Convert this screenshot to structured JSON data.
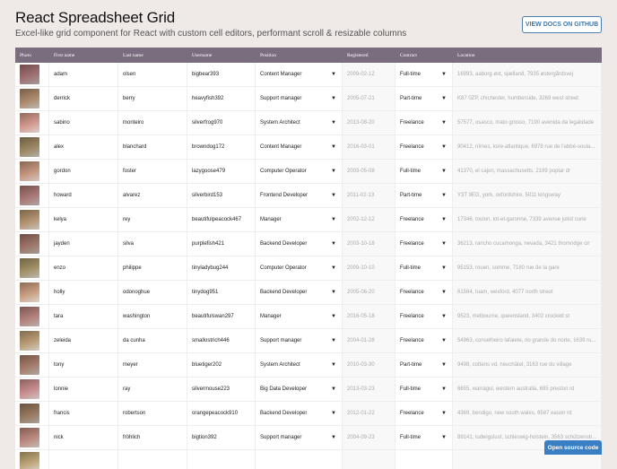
{
  "header": {
    "title": "React Spreadsheet Grid",
    "subtitle": "Excel-like grid component for React with custom cell editors, performant scroll & resizable columns",
    "docs_button": "VIEW DOCS ON GITHUB"
  },
  "columns": [
    "Photo",
    "First name",
    "Last name",
    "Username",
    "Position",
    "Registered",
    "Contract",
    "Location"
  ],
  "rows": [
    [
      "adam",
      "olsen",
      "bigbear393",
      "Content Manager",
      "2009-02-12",
      "Full-time",
      "16993, aaborg øst, sjælland, 7935 østergårdsvej"
    ],
    [
      "derrick",
      "berry",
      "heavyfish392",
      "Support manager",
      "2005-07-21",
      "Part-time",
      "K87 0ZP, chichester, humberside, 3269 west street"
    ],
    [
      "sabino",
      "monteiro",
      "silverfrog970",
      "System Architect",
      "2013-08-20",
      "Freelance",
      "57577, osasco, mato grosso, 7190 avenida da legalidade"
    ],
    [
      "alex",
      "blanchard",
      "browndog172",
      "Content Manager",
      "2016-03-01",
      "Freelance",
      "90412, nîmes, loire-atlantique, 6978 rue de l'abbé-soula..."
    ],
    [
      "gordon",
      "foster",
      "lazygoose479",
      "Computer Operator",
      "2003-05-08",
      "Full-time",
      "41370, el cajon, massachusetts, 2199 poplar dr"
    ],
    [
      "howard",
      "alvarez",
      "silverbird153",
      "Frontend Developer",
      "2011-02-13",
      "Part-time",
      "Y3T 9EG, york, oxfordshire, 5011 kingsway"
    ],
    [
      "kelya",
      "rey",
      "beautifulpeacock467",
      "Manager",
      "2002-12-12",
      "Freelance",
      "17346, toulon, lot-et-garonne, 7339 avenue joliot curie"
    ],
    [
      "jayden",
      "silva",
      "purplefish421",
      "Backend Developer",
      "2003-10-18",
      "Freelance",
      "36213, rancho cucamonga, nevada, 3421 thornridge cir"
    ],
    [
      "enzo",
      "philippe",
      "tinyladybug244",
      "Computer Operator",
      "2009-10-10",
      "Full-time",
      "95153, rouen, somme, 7180 rue de la gare"
    ],
    [
      "holly",
      "odonoghue",
      "tinydog951",
      "Backend Developer",
      "2005-06-20",
      "Freelance",
      "61564, tuam, wexford, 4077 north street"
    ],
    [
      "tara",
      "washington",
      "beautifulswan297",
      "Manager",
      "2016-05-18",
      "Freelance",
      "9523, melbourne, queensland, 3402 crockett st"
    ],
    [
      "zeleida",
      "da cunha",
      "smallostrich446",
      "Support manager",
      "2004-01-28",
      "Freelance",
      "54963, conselheiro lafaiete, rio grande do norte, 1639 ru..."
    ],
    [
      "tony",
      "meyer",
      "bluetiger202",
      "System Architect",
      "2010-03-30",
      "Part-time",
      "9498, cottens vd, neuchâtel, 3163 rue du village"
    ],
    [
      "lonnie",
      "ray",
      "silvermouse223",
      "Big Data Developer",
      "2013-03-23",
      "Full-time",
      "6655, warragul, western australia, 695 preston rd"
    ],
    [
      "francis",
      "robertson",
      "orangepeacock910",
      "Backend Developer",
      "2012-01-22",
      "Freelance",
      "4369, bendigo, new south wales, 6587 eason rd"
    ],
    [
      "nick",
      "fröhlich",
      "bigtion392",
      "Support manager",
      "2004-09-23",
      "Full-time",
      "89141, ludwigslust, schleswig-holstein, 3563 schützenstr..."
    ]
  ],
  "footer": {
    "source_button": "Open source code"
  }
}
